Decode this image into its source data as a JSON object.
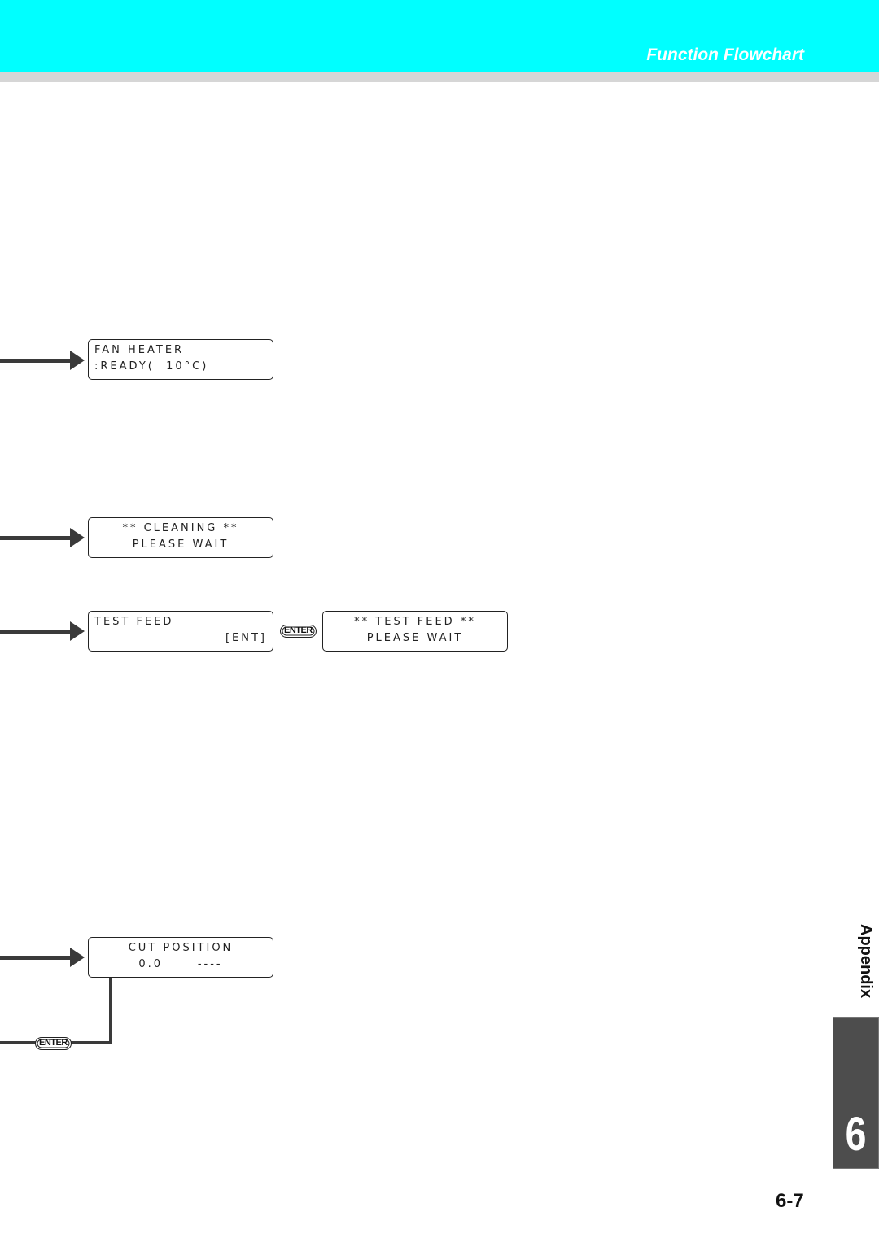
{
  "header": {
    "title": "Function Flowchart",
    "color": "#00ffff"
  },
  "screens": {
    "fan_heater": {
      "line1": "FAN HEATER",
      "line2": ":READY(  10°C)"
    },
    "cleaning": {
      "line1": "** CLEANING **",
      "line2": "PLEASE WAIT"
    },
    "test_feed": {
      "line1": "TEST FEED",
      "line2": "[ENT]"
    },
    "test_feed_wait": {
      "line1": "** TEST FEED **",
      "line2": "PLEASE WAIT"
    },
    "cut_position": {
      "line1": "CUT POSITION",
      "line2": "0.0      ----"
    }
  },
  "keys": {
    "enter_label": "ENTER"
  },
  "sidebar": {
    "section_label": "Appendix",
    "chapter_number": "6"
  },
  "footer": {
    "page_number": "6-7"
  }
}
